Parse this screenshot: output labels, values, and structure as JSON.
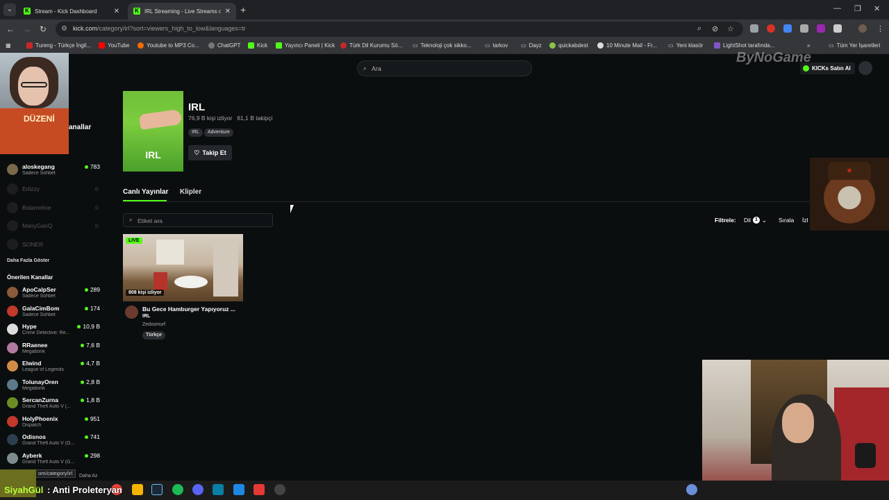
{
  "browser": {
    "tabs": [
      {
        "title": "Stream - Kick Dashboard",
        "active": false
      },
      {
        "title": "IRL Streaming - Live Streams on",
        "active": true
      }
    ],
    "url_host": "kick.com",
    "url_path": "/category/irl?sort=viewers_high_to_low&languages=tr",
    "bookmarks": [
      "Tureng - Türkçe İngil...",
      "YouTube",
      "Youtube to MP3 Co...",
      "ChatGPT",
      "Kick",
      "Yayıncı Paneli | Kick",
      "Türk Dil Kurumu Sö...",
      "Teknoloji çok sikko...",
      "tarkov",
      "Dayz",
      "quickabdest",
      "10 Minute Mail - Fr...",
      "Yeni klasör",
      "LightShot tarafında..."
    ],
    "bookmarks_all": "Tüm Yer İşaretleri",
    "status_url": "om/category/irl"
  },
  "header": {
    "search_placeholder": "Ara",
    "kicks_label": "KICKs Satın Al"
  },
  "sidebar": {
    "followed_title": "Takip Edilen Kanallar",
    "followed_title_visible": "anallar",
    "followed": [
      {
        "name": "aloskegang",
        "sub": "Sadece Sohbet",
        "count": "783",
        "live": true
      },
      {
        "name": "Erlizzy",
        "live": false
      },
      {
        "name": "Balamirlive",
        "live": false
      },
      {
        "name": "ManyGanQ",
        "live": false
      },
      {
        "name": "SONER",
        "live": false
      }
    ],
    "show_more": "Daha Fazla Göster",
    "recommended_title": "Önerilen Kanallar",
    "recommended": [
      {
        "name": "ApoCalpSer",
        "sub": "Sadece Sohbet",
        "count": "289"
      },
      {
        "name": "GalaCimBom",
        "sub": "Sadece Sohbet",
        "count": "174"
      },
      {
        "name": "Hype",
        "sub": "Crime Detective: Re...",
        "count": "10,9 B"
      },
      {
        "name": "RRaenee",
        "sub": "Megabonk",
        "count": "7,6 B"
      },
      {
        "name": "Elwind",
        "sub": "League of Legends",
        "count": "4,7 B"
      },
      {
        "name": "TolunayOren",
        "sub": "Megabonk",
        "count": "2,8 B"
      },
      {
        "name": "SercanZurna",
        "sub": "Grand Theft Auto V (...",
        "count": "1,8 B"
      },
      {
        "name": "HolyPhoenix",
        "sub": "Dispatch",
        "count": "951"
      },
      {
        "name": "Odisnos",
        "sub": "Grand Theft Auto V (G...",
        "count": "741"
      },
      {
        "name": "Ayberk",
        "sub": "Grand Theft Auto V (G...",
        "count": "298"
      }
    ],
    "show_less": "Daha Az"
  },
  "category": {
    "image_label": "IRL",
    "title": "IRL",
    "viewers": "76,9 B kişi izliyor",
    "followers": "61,1 B takipçi",
    "tags": [
      "IRL",
      "Adventure"
    ],
    "follow_label": "Takip Et"
  },
  "tabs": {
    "live": "Canlı Yayınlar",
    "clips": "Klipler"
  },
  "filters": {
    "tag_search_placeholder": "Etiket ara",
    "filter_label": "Filtrele:",
    "language_label": "Dil",
    "language_count": "1",
    "sort_label": "Sırala",
    "sort_value_visible": "İzl"
  },
  "stream": {
    "live_badge": "LIVE",
    "viewers": "808 kişi izliyor",
    "title": "Bu Gece Hamburger Yapıyoruz ...",
    "category": "IRL",
    "streamer": "Zedxsmurf",
    "tag": "Türkçe"
  },
  "overlays": {
    "brand": "ByNoGame",
    "book_text": "DÜZENİ",
    "chat_user": "SiyahGül",
    "chat_message": ": Anti Proleteryan"
  },
  "colors": {
    "kick_green": "#53fc18",
    "page_bg": "#0b0e0f"
  }
}
